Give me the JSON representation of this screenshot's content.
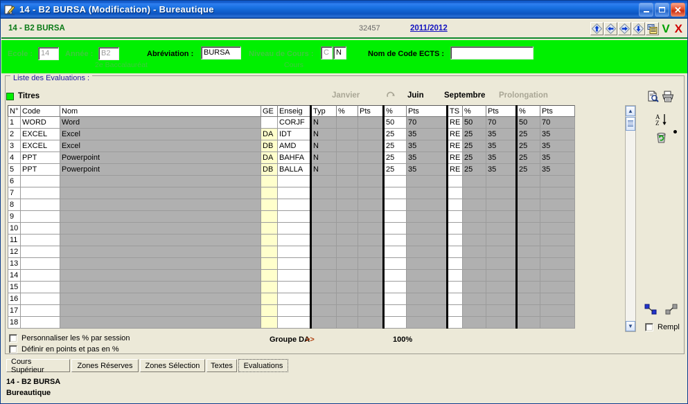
{
  "window": {
    "title": "14 - B2    BURSA (Modification) - Bureautique",
    "app_icon": "pencil-document-icon",
    "minimize": "_",
    "maximize": "□",
    "close": "✕"
  },
  "infobar": {
    "code": "14 - B2    BURSA",
    "record_number": "32457",
    "school_year": "2011/2012",
    "nav": [
      {
        "name": "nav-first",
        "icon": "arrow-up-diamond-icon"
      },
      {
        "name": "nav-previous",
        "icon": "arrow-left-diamond-icon"
      },
      {
        "name": "nav-next",
        "icon": "arrow-right-diamond-icon"
      },
      {
        "name": "nav-last",
        "icon": "arrow-down-diamond-icon"
      },
      {
        "name": "list-view",
        "icon": "list-card-icon"
      }
    ],
    "confirm": "V",
    "cancel": "X"
  },
  "form": {
    "ecole_label": "Ecole :",
    "ecole_value": "14",
    "annee_label": "Année :",
    "annee_value": "B2",
    "annee_sub": "2e Baccalauréat",
    "abrev_label": "Abréviation :",
    "abrev_value": "BURSA",
    "niveau_label": "Niveau de Cours :",
    "niveau_value_1": "C",
    "niveau_value_2": "N",
    "niveau_sub": "Cours",
    "ects_label": "Nom de Code ECTS :",
    "ects_value": "",
    "ects_placeholder": ""
  },
  "groupbox": {
    "legend": "Liste des Evaluations :"
  },
  "titres": {
    "label": "Titres",
    "marker_color": "#00f000"
  },
  "sessions": [
    {
      "label": "Janvier",
      "active": false
    },
    {
      "label": "Juin",
      "active": true
    },
    {
      "label": "Septembre",
      "active": true
    },
    {
      "label": "Prolongation",
      "active": false
    }
  ],
  "refresh_icon": "refresh-circular-arrow-icon",
  "table": {
    "headers": [
      "N°",
      "Code",
      "Nom",
      "GE",
      "Enseig",
      "Typ",
      "%",
      "Pts",
      "%",
      "Pts",
      "TS",
      "%",
      "Pts",
      "%",
      "Pts"
    ],
    "rows": [
      {
        "n": "1",
        "code": "WORD",
        "nom": "Word",
        "ge": "",
        "enseig": "CORJF",
        "typ": "N",
        "jan_pct": "",
        "jan_pts": "",
        "juin_pct": "50",
        "juin_pts": "70",
        "ts": "RE",
        "sep_pct": "50",
        "sep_pts": "70",
        "pro_pct": "50",
        "pro_pts": "70"
      },
      {
        "n": "2",
        "code": "EXCEL",
        "nom": "Excel",
        "ge": "DA",
        "enseig": "IDT",
        "typ": "N",
        "jan_pct": "",
        "jan_pts": "",
        "juin_pct": "25",
        "juin_pts": "35",
        "ts": "RE",
        "sep_pct": "25",
        "sep_pts": "35",
        "pro_pct": "25",
        "pro_pts": "35"
      },
      {
        "n": "3",
        "code": "EXCEL",
        "nom": "Excel",
        "ge": "DB",
        "enseig": "AMD",
        "typ": "N",
        "jan_pct": "",
        "jan_pts": "",
        "juin_pct": "25",
        "juin_pts": "35",
        "ts": "RE",
        "sep_pct": "25",
        "sep_pts": "35",
        "pro_pct": "25",
        "pro_pts": "35"
      },
      {
        "n": "4",
        "code": "PPT",
        "nom": "Powerpoint",
        "ge": "DA",
        "enseig": "BAHFA",
        "typ": "N",
        "jan_pct": "",
        "jan_pts": "",
        "juin_pct": "25",
        "juin_pts": "35",
        "ts": "RE",
        "sep_pct": "25",
        "sep_pts": "35",
        "pro_pct": "25",
        "pro_pts": "35"
      },
      {
        "n": "5",
        "code": "PPT",
        "nom": "Powerpoint",
        "ge": "DB",
        "enseig": "BALLA",
        "typ": "N",
        "jan_pct": "",
        "jan_pts": "",
        "juin_pct": "25",
        "juin_pts": "35",
        "ts": "RE",
        "sep_pct": "25",
        "sep_pts": "35",
        "pro_pct": "25",
        "pro_pts": "35"
      },
      {
        "n": "6",
        "code": "",
        "nom": "",
        "ge": "",
        "enseig": "",
        "typ": "",
        "jan_pct": "",
        "jan_pts": "",
        "juin_pct": "",
        "juin_pts": "",
        "ts": "",
        "sep_pct": "",
        "sep_pts": "",
        "pro_pct": "",
        "pro_pts": ""
      },
      {
        "n": "7",
        "code": "",
        "nom": "",
        "ge": "",
        "enseig": "",
        "typ": "",
        "jan_pct": "",
        "jan_pts": "",
        "juin_pct": "",
        "juin_pts": "",
        "ts": "",
        "sep_pct": "",
        "sep_pts": "",
        "pro_pct": "",
        "pro_pts": ""
      },
      {
        "n": "8",
        "code": "",
        "nom": "",
        "ge": "",
        "enseig": "",
        "typ": "",
        "jan_pct": "",
        "jan_pts": "",
        "juin_pct": "",
        "juin_pts": "",
        "ts": "",
        "sep_pct": "",
        "sep_pts": "",
        "pro_pct": "",
        "pro_pts": ""
      },
      {
        "n": "9",
        "code": "",
        "nom": "",
        "ge": "",
        "enseig": "",
        "typ": "",
        "jan_pct": "",
        "jan_pts": "",
        "juin_pct": "",
        "juin_pts": "",
        "ts": "",
        "sep_pct": "",
        "sep_pts": "",
        "pro_pct": "",
        "pro_pts": ""
      },
      {
        "n": "10",
        "code": "",
        "nom": "",
        "ge": "",
        "enseig": "",
        "typ": "",
        "jan_pct": "",
        "jan_pts": "",
        "juin_pct": "",
        "juin_pts": "",
        "ts": "",
        "sep_pct": "",
        "sep_pts": "",
        "pro_pct": "",
        "pro_pts": ""
      },
      {
        "n": "11",
        "code": "",
        "nom": "",
        "ge": "",
        "enseig": "",
        "typ": "",
        "jan_pct": "",
        "jan_pts": "",
        "juin_pct": "",
        "juin_pts": "",
        "ts": "",
        "sep_pct": "",
        "sep_pts": "",
        "pro_pct": "",
        "pro_pts": ""
      },
      {
        "n": "12",
        "code": "",
        "nom": "",
        "ge": "",
        "enseig": "",
        "typ": "",
        "jan_pct": "",
        "jan_pts": "",
        "juin_pct": "",
        "juin_pts": "",
        "ts": "",
        "sep_pct": "",
        "sep_pts": "",
        "pro_pct": "",
        "pro_pts": ""
      },
      {
        "n": "13",
        "code": "",
        "nom": "",
        "ge": "",
        "enseig": "",
        "typ": "",
        "jan_pct": "",
        "jan_pts": "",
        "juin_pct": "",
        "juin_pts": "",
        "ts": "",
        "sep_pct": "",
        "sep_pts": "",
        "pro_pct": "",
        "pro_pts": ""
      },
      {
        "n": "14",
        "code": "",
        "nom": "",
        "ge": "",
        "enseig": "",
        "typ": "",
        "jan_pct": "",
        "jan_pts": "",
        "juin_pct": "",
        "juin_pts": "",
        "ts": "",
        "sep_pct": "",
        "sep_pts": "",
        "pro_pct": "",
        "pro_pts": ""
      },
      {
        "n": "15",
        "code": "",
        "nom": "",
        "ge": "",
        "enseig": "",
        "typ": "",
        "jan_pct": "",
        "jan_pts": "",
        "juin_pct": "",
        "juin_pts": "",
        "ts": "",
        "sep_pct": "",
        "sep_pts": "",
        "pro_pct": "",
        "pro_pts": ""
      },
      {
        "n": "16",
        "code": "",
        "nom": "",
        "ge": "",
        "enseig": "",
        "typ": "",
        "jan_pct": "",
        "jan_pts": "",
        "juin_pct": "",
        "juin_pts": "",
        "ts": "",
        "sep_pct": "",
        "sep_pts": "",
        "pro_pct": "",
        "pro_pts": ""
      },
      {
        "n": "17",
        "code": "",
        "nom": "",
        "ge": "",
        "enseig": "",
        "typ": "",
        "jan_pct": "",
        "jan_pts": "",
        "juin_pct": "",
        "juin_pts": "",
        "ts": "",
        "sep_pct": "",
        "sep_pts": "",
        "pro_pct": "",
        "pro_pts": ""
      },
      {
        "n": "18",
        "code": "",
        "nom": "",
        "ge": "",
        "enseig": "",
        "typ": "",
        "jan_pct": "",
        "jan_pts": "",
        "juin_pct": "",
        "juin_pts": "",
        "ts": "",
        "sep_pct": "",
        "sep_pts": "",
        "pro_pct": "",
        "pro_pts": ""
      }
    ]
  },
  "side_tools": [
    {
      "name": "print-preview-icon",
      "title": "Aperçu"
    },
    {
      "name": "print-icon",
      "title": "Imprimer"
    },
    {
      "name": "sort-az-icon",
      "title": "Trier"
    },
    {
      "name": "recycle-delete-icon",
      "title": "Supprimer"
    },
    {
      "name": "expand-arrow-blue-icon",
      "title": "Etendre"
    },
    {
      "name": "collapse-arrow-gray-icon",
      "title": "Réduire"
    }
  ],
  "rempl": {
    "label": "Rempl",
    "checked": false
  },
  "options": {
    "personnaliser": "Personnaliser les % par session",
    "definir": "Définir en points et pas en %",
    "groupe": "Groupe DA",
    "groupe_arrows": ">>",
    "total_pct": "100%"
  },
  "tabs": [
    {
      "label": "Cours Supérieur",
      "selected": false
    },
    {
      "label": "Zones Réserves",
      "selected": false
    },
    {
      "label": "Zones Sélection",
      "selected": false
    },
    {
      "label": "Textes",
      "selected": false
    },
    {
      "label": "Evaluations",
      "selected": true
    }
  ],
  "status": {
    "line1": "14 - B2    BURSA",
    "line2": "Bureautique"
  },
  "colors": {
    "accent_green": "#00f000",
    "title_blue": "#176fe0",
    "chrome": "#ece9d8",
    "grid_gray": "#b0b0b0",
    "highlight_yellow": "#ffffcc"
  }
}
